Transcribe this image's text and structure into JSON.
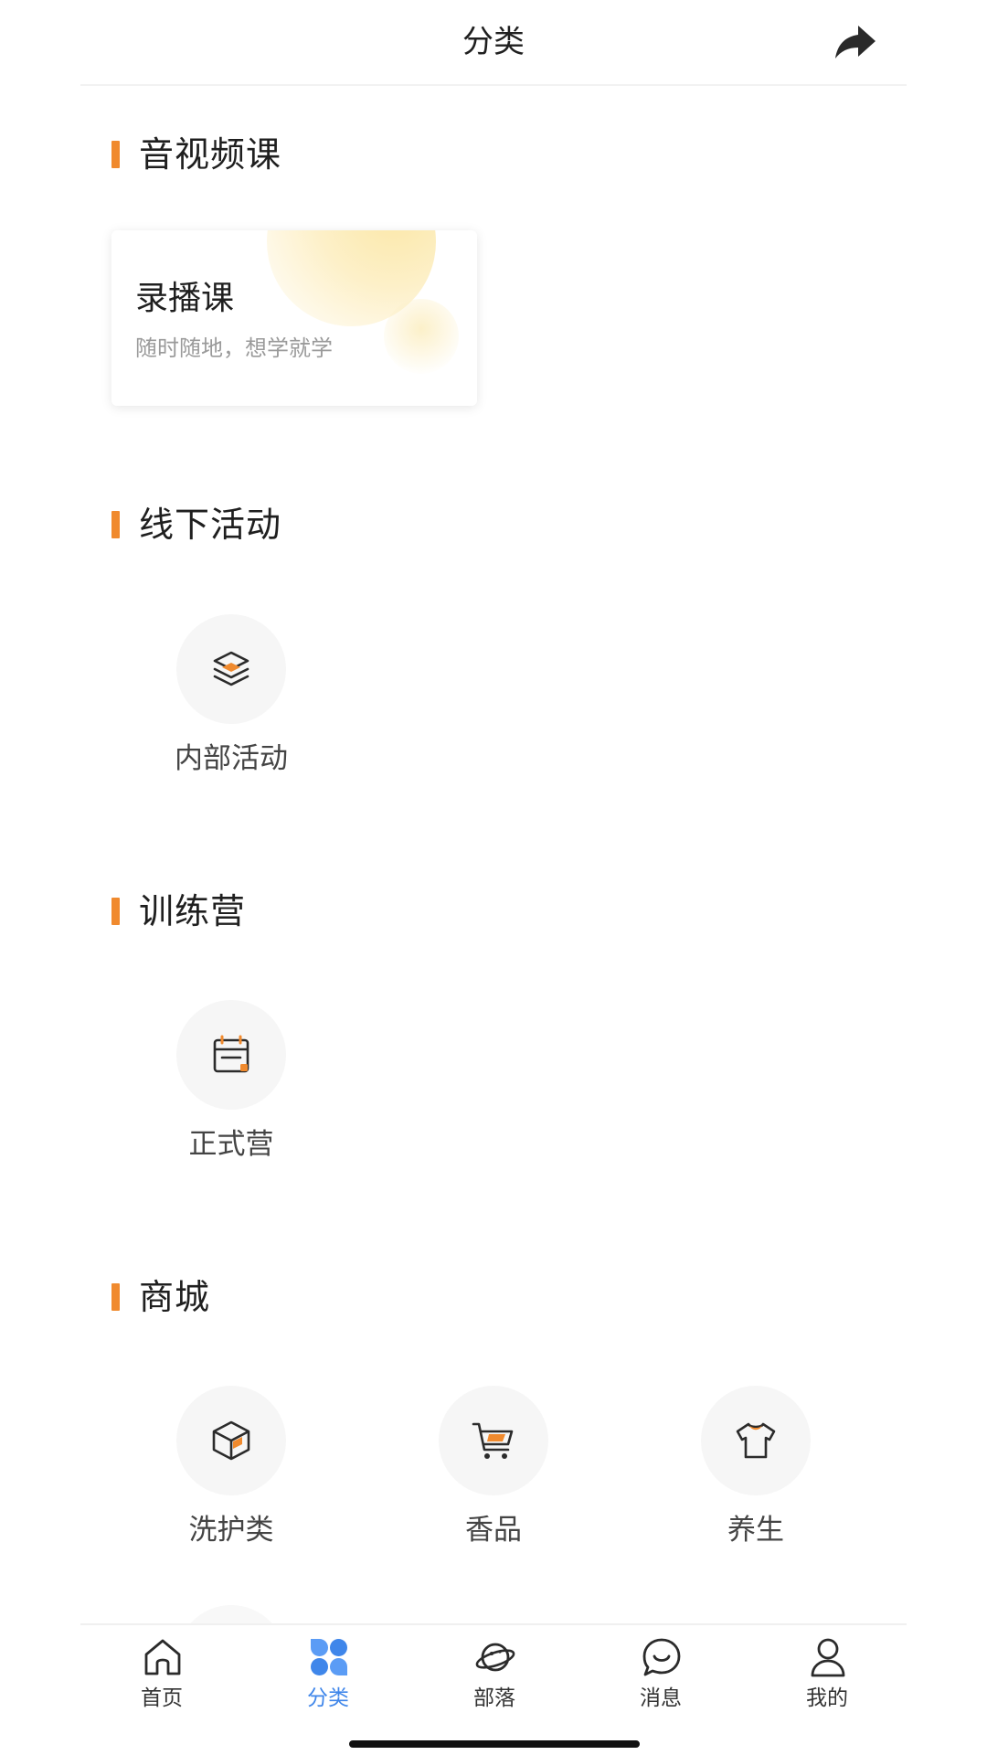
{
  "header": {
    "title": "分类",
    "share_icon": "share-arrow-icon"
  },
  "sections": {
    "av_courses": {
      "title": "音视频课",
      "card": {
        "title": "录播课",
        "subtitle": "随时随地，想学就学"
      }
    },
    "offline": {
      "title": "线下活动",
      "items": [
        {
          "label": "内部活动",
          "icon": "layers-icon"
        }
      ]
    },
    "camp": {
      "title": "训练营",
      "items": [
        {
          "label": "正式营",
          "icon": "calendar-icon"
        }
      ]
    },
    "mall": {
      "title": "商城",
      "items": [
        {
          "label": "洗护类",
          "icon": "box-icon"
        },
        {
          "label": "香品",
          "icon": "cart-icon"
        },
        {
          "label": "养生",
          "icon": "tshirt-icon"
        }
      ]
    }
  },
  "tabbar": {
    "active": "分类",
    "items": [
      {
        "label": "首页",
        "icon": "home-icon"
      },
      {
        "label": "分类",
        "icon": "clover-icon"
      },
      {
        "label": "部落",
        "icon": "planet-icon"
      },
      {
        "label": "消息",
        "icon": "chat-icon"
      },
      {
        "label": "我的",
        "icon": "user-icon"
      }
    ]
  },
  "colors": {
    "accent_orange": "#f08a2e",
    "active_blue": "#3f86ea",
    "text_dark": "#1f1f1f",
    "text_gray": "#9a9a9a",
    "icon_circle_bg": "#f6f6f6"
  }
}
